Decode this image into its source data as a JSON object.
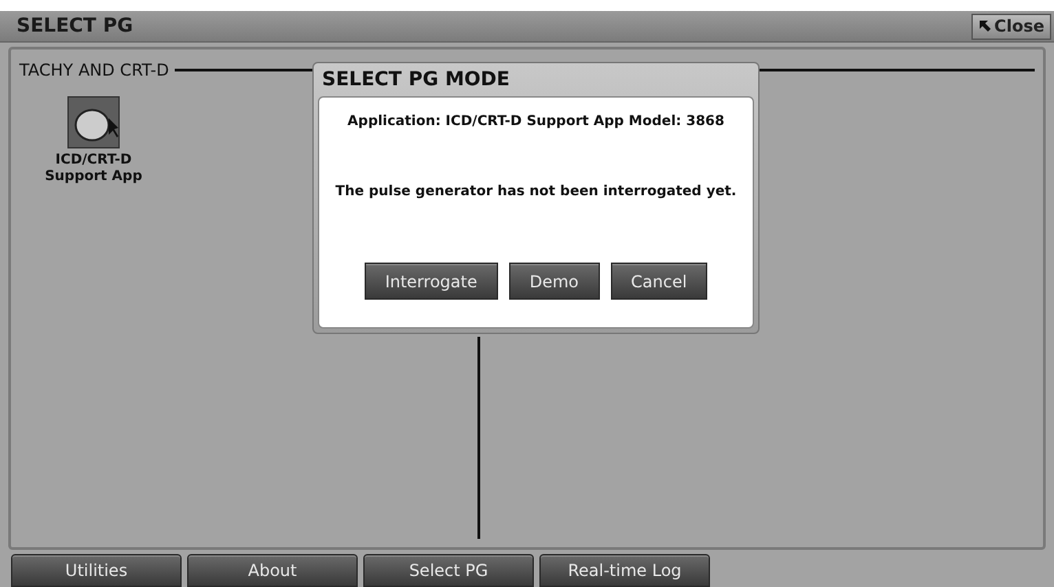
{
  "window": {
    "title": "SELECT PG",
    "close_button": "Close"
  },
  "group": {
    "title": "TACHY AND CRT-D",
    "apps": [
      {
        "label": "ICD/CRT-D\nSupport App"
      }
    ]
  },
  "dialog": {
    "title": "SELECT PG MODE",
    "application": "Application: ICD/CRT-D Support App Model: 3868",
    "message": "The pulse generator has not been interrogated yet.",
    "buttons": [
      "Interrogate",
      "Demo",
      "Cancel"
    ]
  },
  "bottom_tabs": [
    "Utilities",
    "About",
    "Select PG",
    "Real-time Log"
  ]
}
